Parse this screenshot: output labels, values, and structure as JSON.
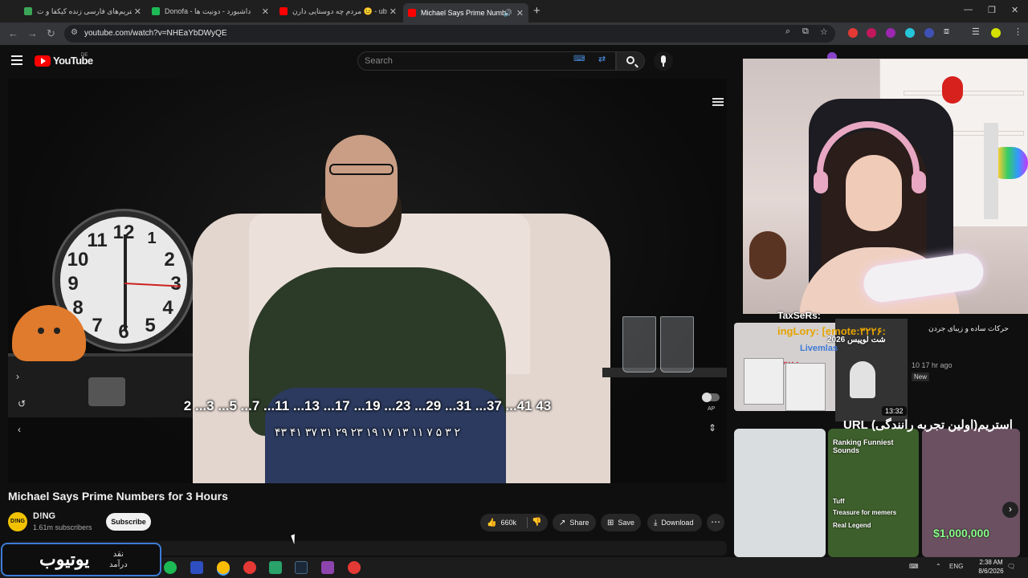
{
  "browser": {
    "tabs": [
      {
        "title": "استریم‌های فارسی زنده کیکفا و ت"
      },
      {
        "title": "Donofa - داشبورد - دونیت ها"
      },
      {
        "title": "مردم چه دوستایی دارن 😐 - ube"
      },
      {
        "title": "Michael Says Prime Numbe"
      }
    ],
    "url": "youtube.com/watch?v=NHEaYbDWyQE"
  },
  "youtube": {
    "logo_text": "YouTube",
    "country": "DE",
    "search_placeholder": "Search"
  },
  "player": {
    "subtitle_line1": "2 ...3 ...5 ...7 ...11 ...13 ...17 ...19 ...23 ...29 ...31 ...37 ...41 43",
    "subtitle_line2": "۴۳ ۴۱ ۳۷ ۳۱ ۲۹ ۲۳ ۱۹ ۱۷ ۱۳ ۱۱ ۷ ۵ ۳ ۲",
    "clock_numbers": [
      "12",
      "1",
      "2",
      "3",
      "4",
      "5",
      "6",
      "7",
      "8",
      "9",
      "10",
      "11"
    ],
    "autoplay_label": "AP"
  },
  "video": {
    "title": "Michael Says Prime Numbers for 3 Hours",
    "channel": "D!NG",
    "subscribers": "1.61m subscribers",
    "subscribe_label": "Subscribe",
    "likes": "660k",
    "share_label": "Share",
    "save_label": "Save",
    "download_label": "Download"
  },
  "overlay": {
    "chat_line1": "TaxSeRs:",
    "chat_line2": "ingLory: [emote:۳۲۲۶:",
    "chat_line3": "شت لوپیس 2026",
    "chat_line4": "Livemlas",
    "chat_line5": "atila۲۲۸۸",
    "recommended_title": "حرکات ساده و زیبای جردن",
    "recommended_meta": "10 17 hr ago",
    "recommended_new": "New",
    "duration": "13:32",
    "shorts_heading": "استریم(اولین تجربه رانندگی) URL",
    "short2_label": "Ranking Funniest Sounds",
    "short2_items": [
      "Tuff",
      "Treasure for memers",
      "Real Legend"
    ],
    "short3_price": "$1,000,000"
  },
  "taskbar": {
    "lang": "ENG",
    "time": "2:38 AM",
    "date": "8/6/2026"
  },
  "watermark": {
    "main": "یوتیوب",
    "side_line1": "نقد",
    "side_line2": "درآمد"
  },
  "colors": {
    "youtube_red": "#ff0000",
    "watermark_border": "#3d7cd6",
    "money_green": "#88ff88"
  }
}
